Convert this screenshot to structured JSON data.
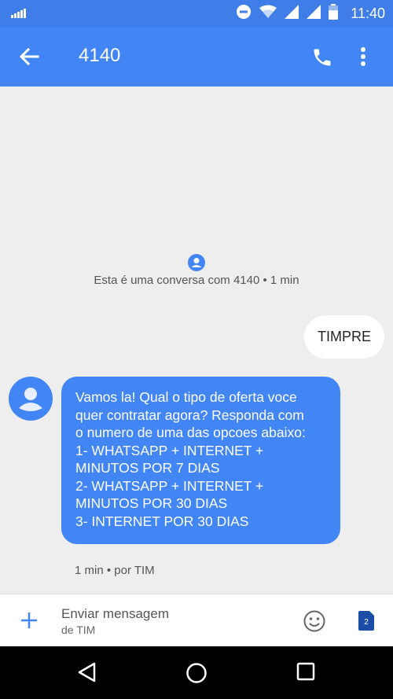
{
  "status_bar": {
    "time": "11:40"
  },
  "app_bar": {
    "title": "4140"
  },
  "conversation": {
    "info_text": "Esta é uma conversa com 4140 • 1 min",
    "messages": [
      {
        "direction": "outgoing",
        "text": "TIMPRE"
      },
      {
        "direction": "incoming",
        "text": "Vamos la! Qual o tipo de oferta voce\nquer contratar agora? Responda com\no numero de uma das opcoes abaixo:\n1- WHATSAPP + INTERNET +\nMINUTOS POR 7 DIAS\n2- WHATSAPP + INTERNET +\nMINUTOS POR 30 DIAS\n3- INTERNET POR 30 DIAS"
      }
    ],
    "incoming_meta": "1 min • por TIM"
  },
  "compose": {
    "placeholder": "Enviar mensagem",
    "sub": "de TIM",
    "sim_badge": "2"
  },
  "colors": {
    "primary": "#4285f4",
    "status_bar": "#3f7ee8",
    "background": "#eeeeee"
  },
  "icons": [
    "signal-icon",
    "dnd-icon",
    "wifi-icon",
    "cell-signal-icon",
    "battery-icon",
    "back-arrow-icon",
    "phone-icon",
    "more-vert-icon",
    "contact-icon",
    "avatar-icon",
    "add-icon",
    "emoji-icon",
    "sim-icon",
    "nav-back-icon",
    "nav-home-icon",
    "nav-recents-icon"
  ]
}
